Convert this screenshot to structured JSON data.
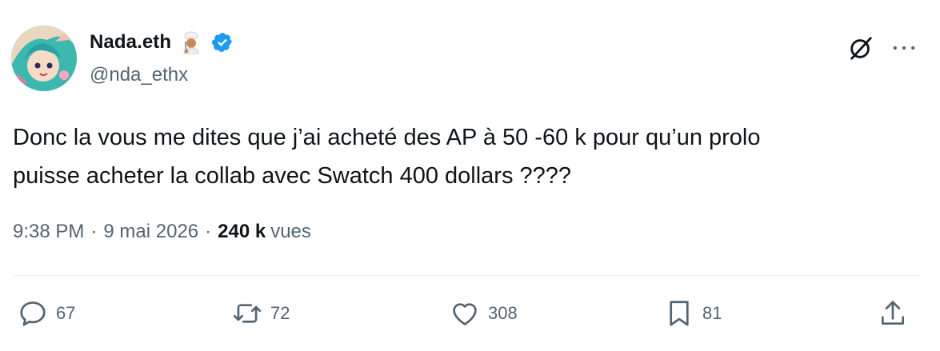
{
  "author": {
    "display_name": "Nada.eth",
    "handle": "@nda_ethx",
    "emoji": "cook-emoji",
    "verified": true,
    "verified_color": "#1d9bf0"
  },
  "tweet": {
    "text": "Donc la vous me dites que j’ai acheté des AP à 50 -60 k pour qu’un prolo\npuisse acheter la collab avec Swatch 400 dollars ????"
  },
  "meta": {
    "time": "9:38 PM",
    "separator": "·",
    "date": "9 mai 2026",
    "views_count": "240 k",
    "views_label": "vues"
  },
  "actions": {
    "replies": "67",
    "reposts": "72",
    "likes": "308",
    "bookmarks": "81"
  },
  "icons": {
    "grok": "grok-icon",
    "more": "more-icon",
    "reply": "reply-icon",
    "repost": "repost-icon",
    "like": "heart-icon",
    "bookmark": "bookmark-icon",
    "share": "share-icon"
  },
  "colors": {
    "text": "#0f1419",
    "secondary": "#536471",
    "divider": "#eff3f4",
    "background": "#ffffff"
  }
}
